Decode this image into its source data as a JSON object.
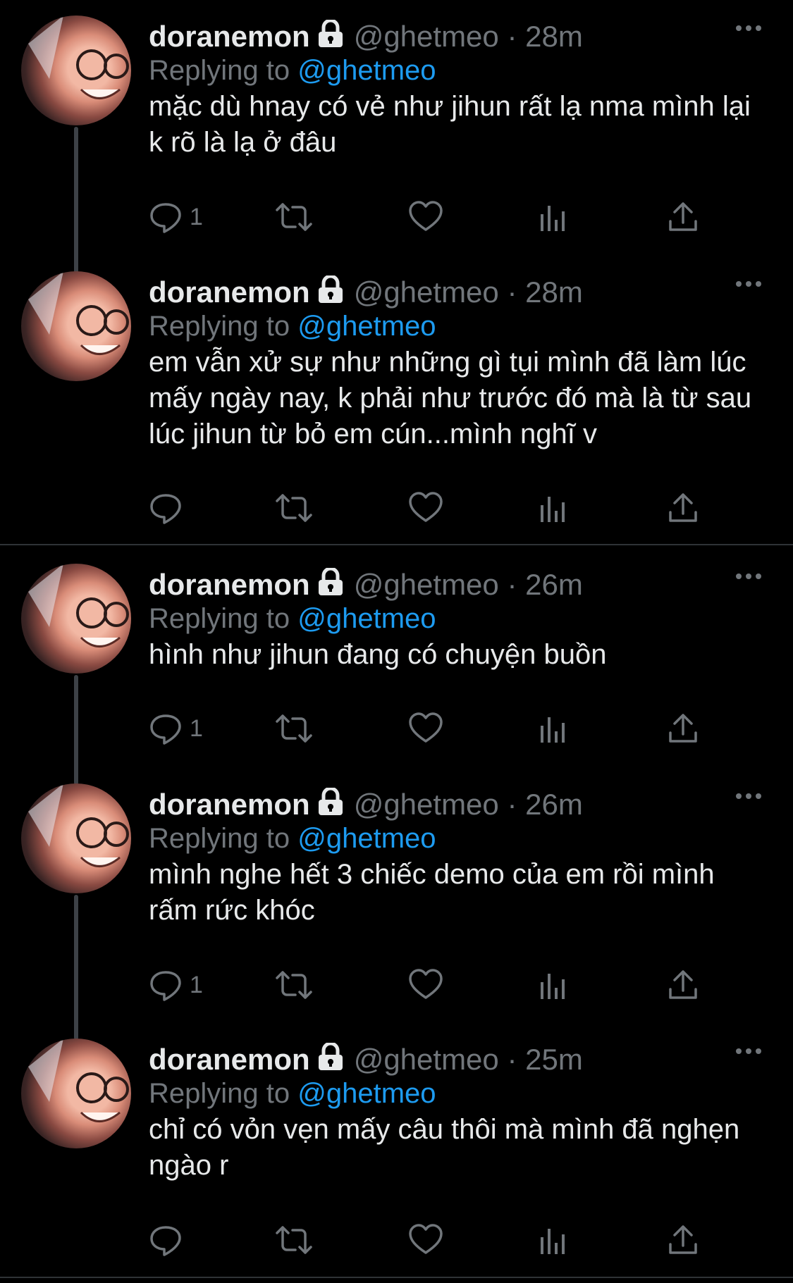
{
  "tweets": [
    {
      "name": "doranemon",
      "handle": "@ghetmeo",
      "time": "28m",
      "replying_prefix": "Replying to",
      "replying_to": "@ghetmeo",
      "text": "mặc dù hnay có vẻ như jihun rất lạ nma mình lại k rõ là lạ ở đâu",
      "reply_count": "1"
    },
    {
      "name": "doranemon",
      "handle": "@ghetmeo",
      "time": "28m",
      "replying_prefix": "Replying to",
      "replying_to": "@ghetmeo",
      "text": "em vẫn xử sự như những gì tụi mình đã làm lúc mấy ngày nay, k phải như trước đó mà là từ sau lúc jihun từ bỏ em cún...mình nghĩ v",
      "reply_count": ""
    },
    {
      "name": "doranemon",
      "handle": "@ghetmeo",
      "time": "26m",
      "replying_prefix": "Replying to",
      "replying_to": "@ghetmeo",
      "text": "hình như jihun đang có chuyện buồn",
      "reply_count": "1"
    },
    {
      "name": "doranemon",
      "handle": "@ghetmeo",
      "time": "26m",
      "replying_prefix": "Replying to",
      "replying_to": "@ghetmeo",
      "text": "mình nghe hết 3 chiếc demo của em rồi mình rấm rức khóc",
      "reply_count": "1"
    },
    {
      "name": "doranemon",
      "handle": "@ghetmeo",
      "time": "25m",
      "replying_prefix": "Replying to",
      "replying_to": "@ghetmeo",
      "text": "chỉ có vỏn vẹn mấy câu thôi mà mình đã nghẹn ngào r",
      "reply_count": ""
    }
  ],
  "separator": "·",
  "icons": {
    "lock": "lock-icon",
    "more": "more-icon",
    "reply": "reply-icon",
    "retweet": "retweet-icon",
    "like": "like-icon",
    "views": "views-icon",
    "share": "share-icon"
  },
  "colors": {
    "background": "#000000",
    "text": "#e7e9ea",
    "secondary": "#71767b",
    "link": "#1d9bf0",
    "divider": "#2f3336",
    "thread_line": "#3d4146"
  }
}
